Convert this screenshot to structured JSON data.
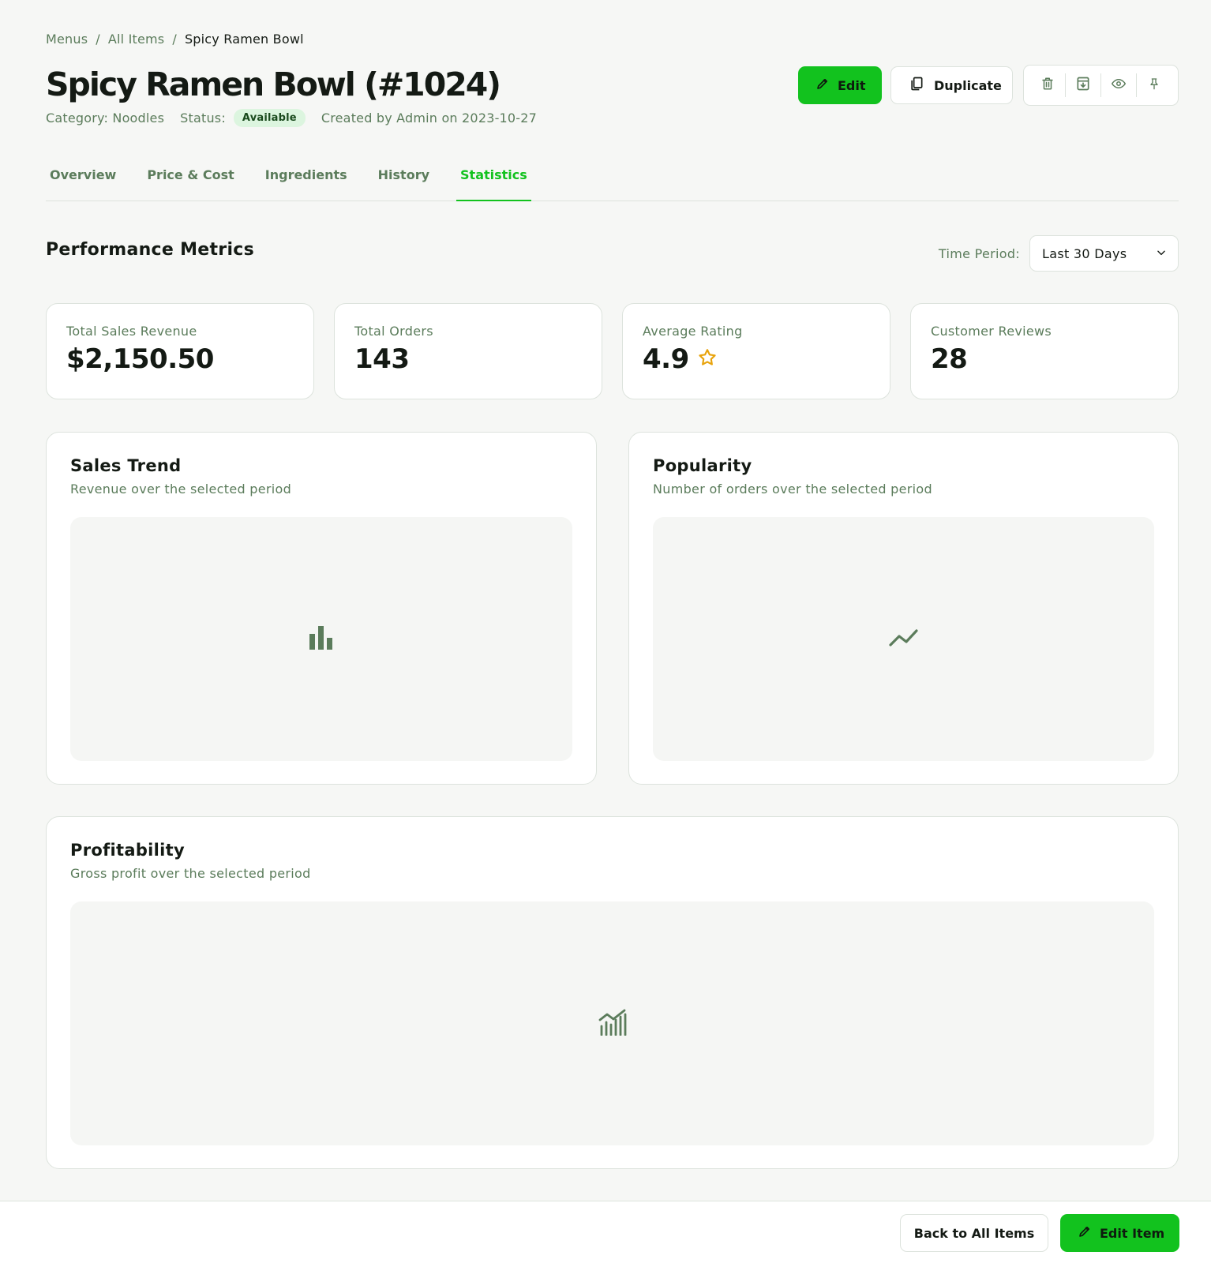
{
  "breadcrumb": {
    "items": [
      "Menus",
      "All Items"
    ],
    "separator": "/",
    "current": "Spicy Ramen Bowl"
  },
  "header": {
    "title": "Spicy Ramen Bowl (#1024)",
    "category": "Category: Noodles",
    "status_label": "Status:",
    "status": "Available",
    "created": "Created by Admin on 2023-10-27",
    "edit_label": "Edit",
    "duplicate_label": "Duplicate",
    "icons": [
      "trash-icon",
      "archive-icon",
      "eye-icon",
      "pin-icon"
    ]
  },
  "tabs": [
    {
      "label": "Overview",
      "active": false
    },
    {
      "label": "Price & Cost",
      "active": false
    },
    {
      "label": "Ingredients",
      "active": false
    },
    {
      "label": "History",
      "active": false
    },
    {
      "label": "Statistics",
      "active": true
    }
  ],
  "section": {
    "title": "Performance Metrics",
    "period_label": "Time Period:",
    "period_value": "Last 30 Days"
  },
  "metrics": [
    {
      "label": "Total Sales Revenue",
      "value": "$2,150.50"
    },
    {
      "label": "Total Orders",
      "value": "143"
    },
    {
      "label": "Average Rating",
      "value": "4.9",
      "icon": "star-icon"
    },
    {
      "label": "Customer Reviews",
      "value": "28"
    }
  ],
  "charts": {
    "sales": {
      "title": "Sales Trend",
      "subtitle": "Revenue over the selected period",
      "icon": "bar-chart-icon"
    },
    "popularity": {
      "title": "Popularity",
      "subtitle": "Number of orders over the selected period",
      "icon": "trend-line-icon"
    },
    "profit": {
      "title": "Profitability",
      "subtitle": "Gross profit over the selected period",
      "icon": "area-chart-icon"
    }
  },
  "footer": {
    "back_label": "Back to All Items",
    "edit_label": "Edit Item"
  },
  "colors": {
    "accent": "#12c21e",
    "muted_text": "#5b7c5b",
    "badge_bg": "#dcf5df",
    "star": "#e8a30c"
  }
}
